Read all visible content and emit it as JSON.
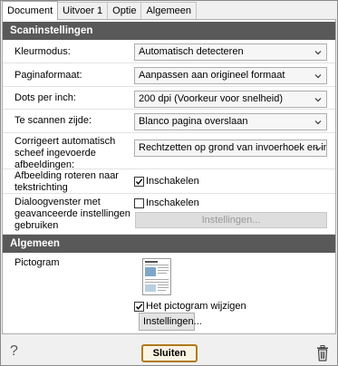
{
  "tabs": [
    {
      "label": "Document"
    },
    {
      "label": "Uitvoer 1"
    },
    {
      "label": "Optie"
    },
    {
      "label": "Algemeen"
    }
  ],
  "scan_section": {
    "header": "Scaninstellingen",
    "color_mode": {
      "label": "Kleurmodus:",
      "value": "Automatisch detecteren"
    },
    "page_format": {
      "label": "Paginaformaat:",
      "value": "Aanpassen aan origineel formaat"
    },
    "dpi": {
      "label": "Dots per inch:",
      "value": "200 dpi (Voorkeur voor snelheid)"
    },
    "side": {
      "label": "Te scannen zijde:",
      "value": "Blanco pagina overslaan"
    },
    "deskew": {
      "label_lines": [
        "Corrigeert automatisch",
        "scheef ingevoerde",
        "afbeeldingen:"
      ],
      "value": "Rechtzetten op grond van invoerhoek en inhoud"
    },
    "rotate": {
      "label_lines": [
        "Afbeelding roteren naar",
        "tekstrichting"
      ],
      "checkbox_label": "Inschakelen",
      "checked": true
    },
    "advanced": {
      "label_lines": [
        "Dialoogvenster met",
        "geavanceerde instellingen",
        "gebruiken"
      ],
      "checkbox_label": "Inschakelen",
      "checked": false,
      "settings_button": "Instellingen..."
    }
  },
  "general_section": {
    "header": "Algemeen",
    "icon": {
      "label": "Pictogram",
      "change_checkbox_label": "Het pictogram wijzigen",
      "checked": true,
      "settings_button": "Instellingen..."
    }
  },
  "footer": {
    "help_symbol": "?",
    "close_button": "Sluiten"
  },
  "colors": {
    "section_header_bg": "#595959",
    "close_border": "#b07a1c",
    "close_bg": "#fbf3e3"
  }
}
